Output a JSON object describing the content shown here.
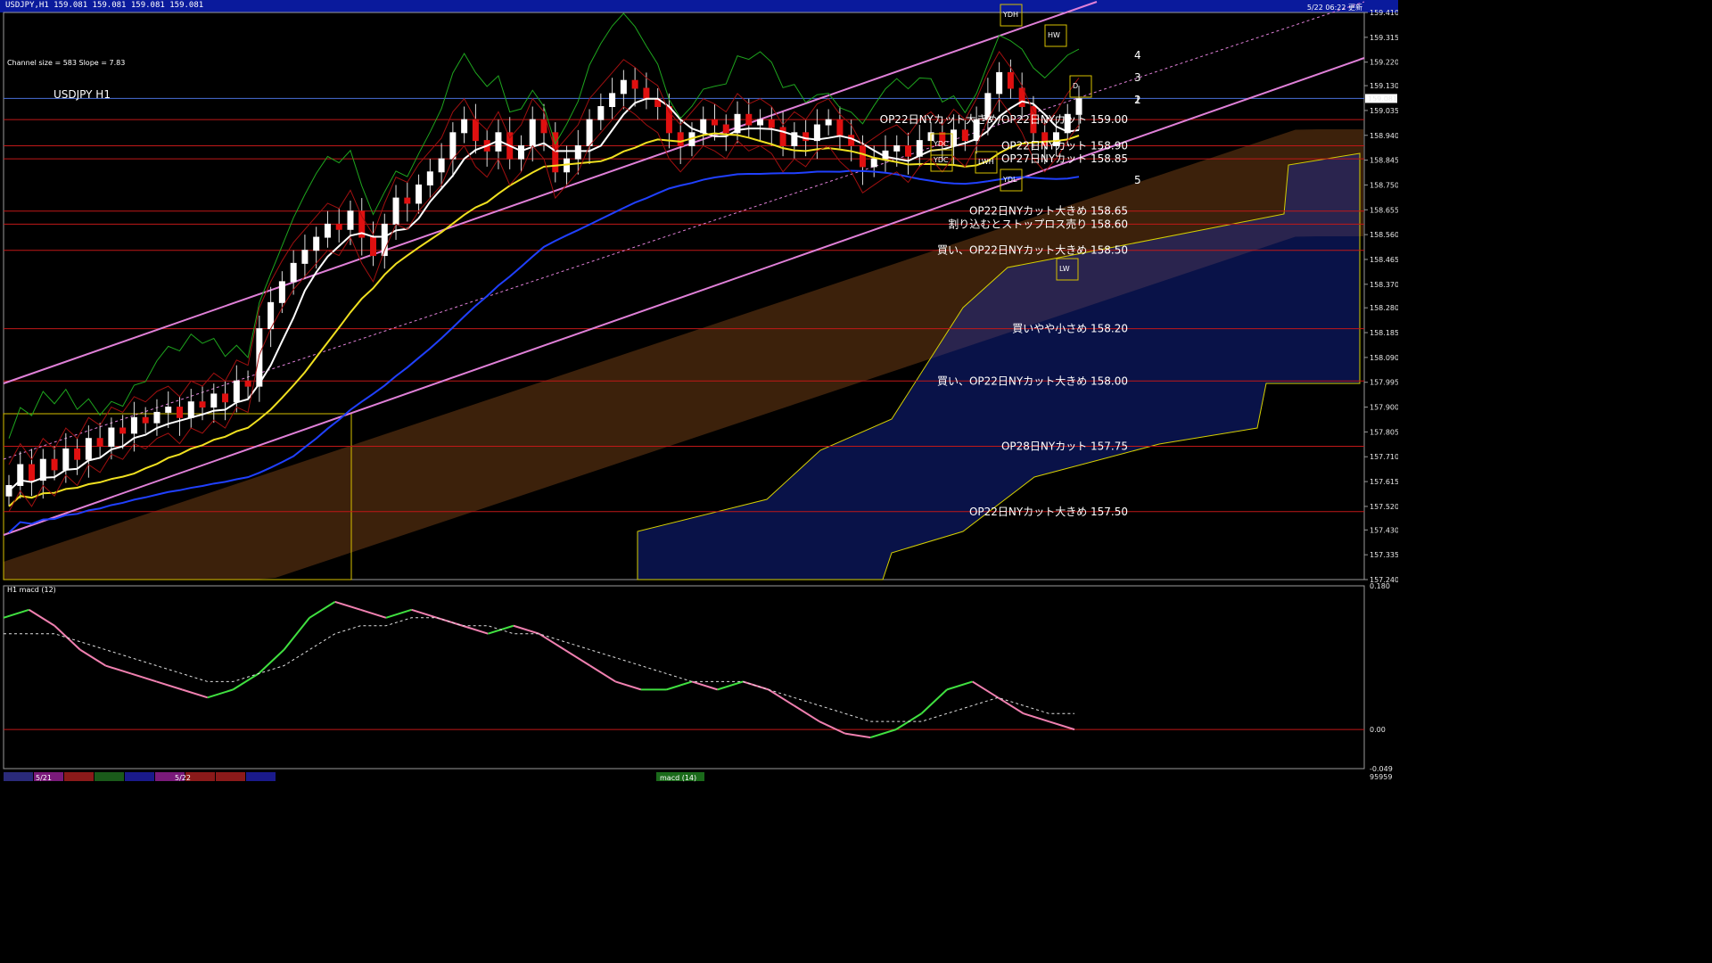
{
  "window": {
    "title_bar_text": "USDJPY,H1  159.081 159.081 159.081 159.081",
    "timestamp": "5/22 06:22 更新"
  },
  "chart_data": [
    {
      "type": "candlestick",
      "title": "USDJPY H1",
      "channel_info": "Channel size = 583 Slope = 7.83",
      "ylim": [
        157.24,
        159.41
      ],
      "y_ticks": [
        159.41,
        159.315,
        159.22,
        159.13,
        159.035,
        158.94,
        158.845,
        158.75,
        158.655,
        158.56,
        158.465,
        158.37,
        158.28,
        158.185,
        158.09,
        157.995,
        157.9,
        157.805,
        157.71,
        157.615,
        157.52,
        157.43,
        157.335,
        157.24
      ],
      "current_price": "159.081",
      "close": [
        157.6,
        157.68,
        157.62,
        157.7,
        157.66,
        157.74,
        157.7,
        157.78,
        157.75,
        157.82,
        157.8,
        157.86,
        157.84,
        157.88,
        157.9,
        157.86,
        157.92,
        157.9,
        157.95,
        157.92,
        158.0,
        157.98,
        158.2,
        158.3,
        158.38,
        158.45,
        158.5,
        158.55,
        158.6,
        158.58,
        158.65,
        158.55,
        158.48,
        158.6,
        158.7,
        158.68,
        158.75,
        158.8,
        158.85,
        158.95,
        159.0,
        158.92,
        158.88,
        158.95,
        158.85,
        158.9,
        159.0,
        158.95,
        158.8,
        158.85,
        158.9,
        159.0,
        159.05,
        159.1,
        159.15,
        159.12,
        159.08,
        159.05,
        158.95,
        158.9,
        158.95,
        159.0,
        158.98,
        158.95,
        159.02,
        158.98,
        159.0,
        158.97,
        158.9,
        158.95,
        158.92,
        158.98,
        159.0,
        158.94,
        158.9,
        158.82,
        158.85,
        158.88,
        158.9,
        158.86,
        158.92,
        158.95,
        158.9,
        158.96,
        158.92,
        159.0,
        159.1,
        159.18,
        159.12,
        159.05,
        158.95,
        158.9,
        158.95,
        159.02,
        159.08
      ],
      "price_lines": [
        {
          "price": 159.0,
          "label": "OP22日NYカット大きめ/OP22日NYカット 159.00"
        },
        {
          "price": 158.9,
          "label": "OP22日NYカット 158.90"
        },
        {
          "price": 158.85,
          "label": "OP27日NYカット 158.85"
        },
        {
          "price": 158.65,
          "label": "OP22日NYカット大きめ 158.65"
        },
        {
          "price": 158.6,
          "label": "割り込むとストップロス売り 158.60"
        },
        {
          "price": 158.5,
          "label": "買い、OP22日NYカット大きめ 158.50"
        },
        {
          "price": 158.2,
          "label": "買いやや小さめ 158.20"
        },
        {
          "price": 158.0,
          "label": "買い、OP22日NYカット大きめ 158.00"
        },
        {
          "price": 157.75,
          "label": "OP28日NYカット 157.75"
        },
        {
          "price": 157.5,
          "label": "OP22日NYカット大きめ 157.50"
        }
      ],
      "box_labels": [
        "YDH",
        "YDL",
        "YDC",
        "YDC",
        "LWH",
        "HW",
        "LW",
        "D"
      ],
      "fib_labels": [
        "1",
        "2",
        "3",
        "4",
        "5"
      ]
    },
    {
      "type": "line",
      "title": "H1 macd (12)",
      "ylim": [
        -0.049,
        0.18
      ],
      "y_ticks": [
        0.18,
        0.0,
        -0.049
      ],
      "footer_value": "95959",
      "series": [
        {
          "values": [
            0.14,
            0.15,
            0.13,
            0.1,
            0.08,
            0.07,
            0.06,
            0.05,
            0.04,
            0.05,
            0.07,
            0.1,
            0.14,
            0.16,
            0.15,
            0.14,
            0.15,
            0.14,
            0.13,
            0.12,
            0.13,
            0.12,
            0.1,
            0.08,
            0.06,
            0.05,
            0.05,
            0.06,
            0.05,
            0.06,
            0.05,
            0.03,
            0.01,
            -0.005,
            -0.01,
            0.0,
            0.02,
            0.05,
            0.06,
            0.04,
            0.02,
            0.01,
            0.0
          ]
        },
        {
          "values": [
            0.12,
            0.12,
            0.12,
            0.11,
            0.1,
            0.09,
            0.08,
            0.07,
            0.06,
            0.06,
            0.07,
            0.08,
            0.1,
            0.12,
            0.13,
            0.13,
            0.14,
            0.14,
            0.13,
            0.13,
            0.12,
            0.12,
            0.11,
            0.1,
            0.09,
            0.08,
            0.07,
            0.06,
            0.06,
            0.06,
            0.05,
            0.04,
            0.03,
            0.02,
            0.01,
            0.01,
            0.01,
            0.02,
            0.03,
            0.04,
            0.03,
            0.02,
            0.02
          ]
        }
      ]
    }
  ],
  "bottom_bar": {
    "dates": [
      "5/21",
      "5/22"
    ],
    "indicator_tab": "macd (14)"
  }
}
